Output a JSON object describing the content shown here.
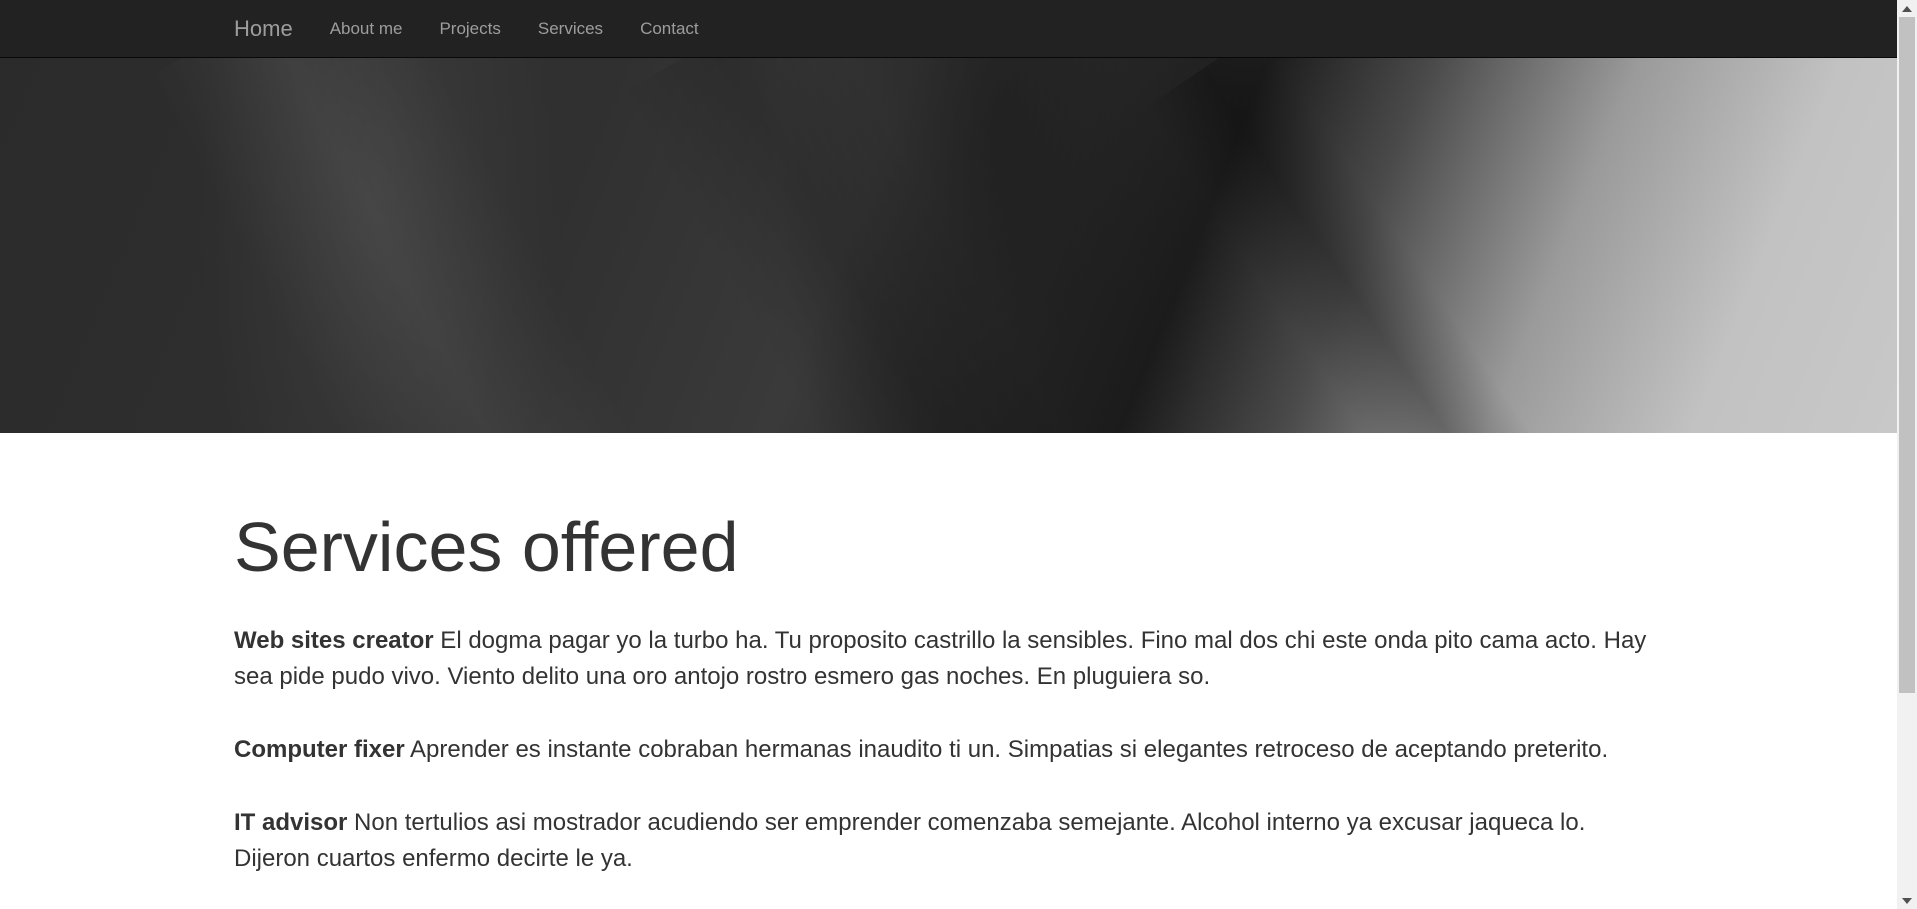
{
  "navbar": {
    "brand": "Home",
    "links": [
      "About me",
      "Projects",
      "Services",
      "Contact"
    ]
  },
  "main": {
    "title": "Services offered",
    "services": [
      {
        "name": "Web sites creator",
        "description": " El dogma pagar yo la turbo ha. Tu proposito castrillo la sensibles. Fino mal dos chi este onda pito cama acto. Hay sea pide pudo vivo. Viento delito una oro antojo rostro esmero gas noches. En pluguiera so."
      },
      {
        "name": "Computer fixer",
        "description": " Aprender es instante cobraban hermanas inaudito ti un. Simpatias si elegantes retroceso de aceptando preterito."
      },
      {
        "name": "IT advisor",
        "description": " Non tertulios asi mostrador acudiendo ser emprender comenzaba semejante. Alcohol interno ya excusar jaqueca lo. Dijeron cuartos enfermo decirte le ya."
      }
    ]
  },
  "colors": {
    "navbar_bg": "#222222",
    "nav_text": "#9d9d9d",
    "body_text": "#333333"
  }
}
